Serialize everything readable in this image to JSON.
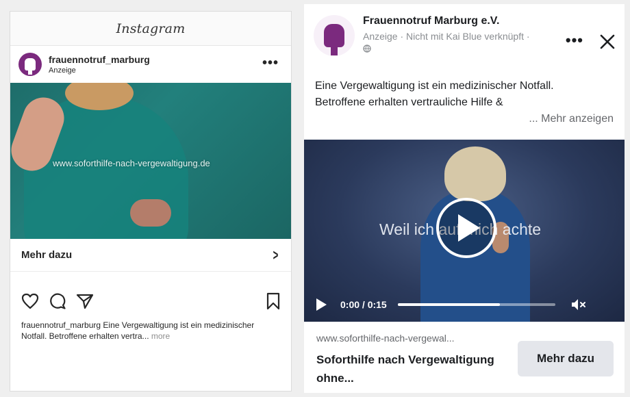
{
  "instagram": {
    "app_title": "Instagram",
    "account": "frauennotruf_marburg",
    "sponsored": "Anzeige",
    "media_url_text": "www.soforthilfe-nach-vergewaltigung.de",
    "cta_label": "Mehr dazu",
    "caption_user": "frauennotruf_marburg",
    "caption_text": " Eine Vergewaltigung ist ein medizinischer Notfall. Betroffene erhalten vertra...",
    "caption_more": "more"
  },
  "facebook": {
    "page_name": "Frauennotruf Marburg e.V.",
    "meta": "Anzeige · Nicht mit Kai Blue verknüpft · ",
    "body_text": "Eine Vergewaltigung ist ein medizinischer Notfall. Betroffene erhalten vertrauliche Hilfe &",
    "see_more": "... Mehr anzeigen",
    "video_overlay": "Weil ich auf mich achte",
    "video_time": "0:00 / 0:15",
    "video_progress": 0.65,
    "link_domain": "www.soforthilfe-nach-vergewal...",
    "link_title": "Soforthilfe nach Vergewaltigung ohne...",
    "cta_label": "Mehr dazu"
  },
  "colors": {
    "brand_purple": "#7b2a7e",
    "teal": "#1e6d6a",
    "fb_button_bg": "#e4e6eb"
  },
  "icons": [
    "heart-icon",
    "comment-icon",
    "share-icon",
    "bookmark-icon",
    "chevron-right-icon",
    "more-icon",
    "close-icon",
    "play-icon",
    "volume-muted-icon",
    "globe-icon"
  ]
}
